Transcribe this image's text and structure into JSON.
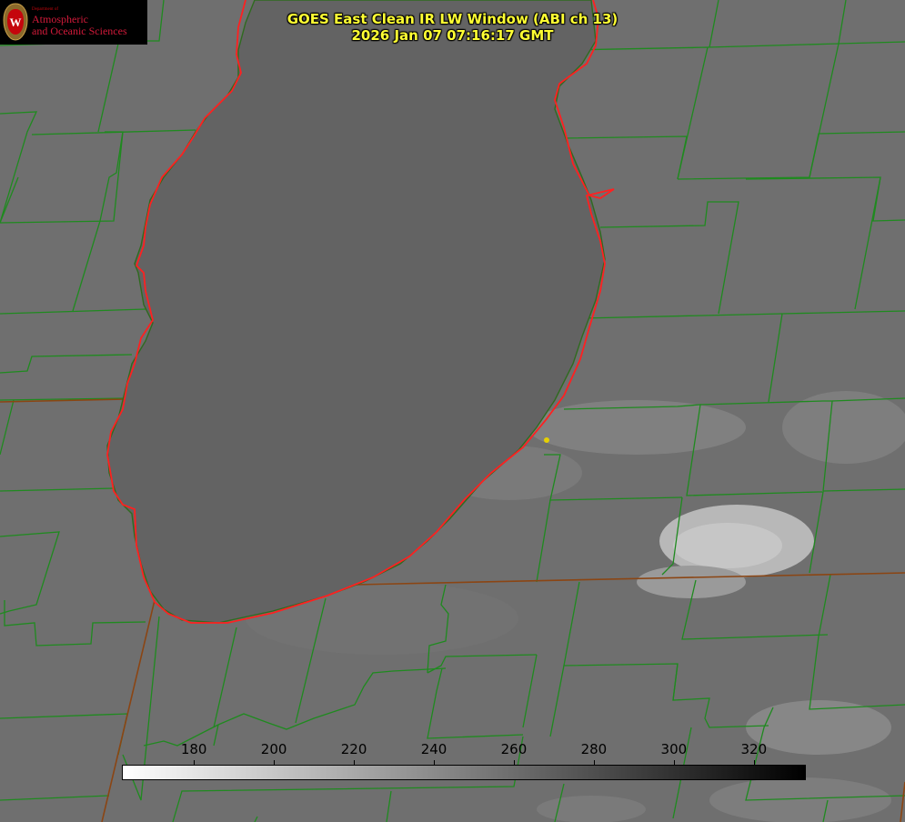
{
  "logo": {
    "department_line": "Department of",
    "name_line1": "Atmospheric",
    "name_line2": "and Oceanic Sciences",
    "seal_letter": "W",
    "colors": {
      "text": "#d21a3a",
      "seal": "#c5050c",
      "background": "#000000"
    }
  },
  "title": {
    "line1": "GOES East Clean IR LW Window (ABI ch 13)",
    "line2": "2026 Jan 07 07:16:17 GMT",
    "color": "#ffff33"
  },
  "colorbar": {
    "ticks": [
      "180",
      "200",
      "220",
      "240",
      "260",
      "280",
      "300",
      "320"
    ],
    "range": [
      162,
      333
    ],
    "colormap": "white-to-black grayscale"
  },
  "map_colors": {
    "background": "#6e6e6e",
    "lake": "#656565",
    "county_lines": "#228b22",
    "state_lines": "#8b4513",
    "lake_shoreline": "#ff2020",
    "station_marker": "#e6d000"
  }
}
